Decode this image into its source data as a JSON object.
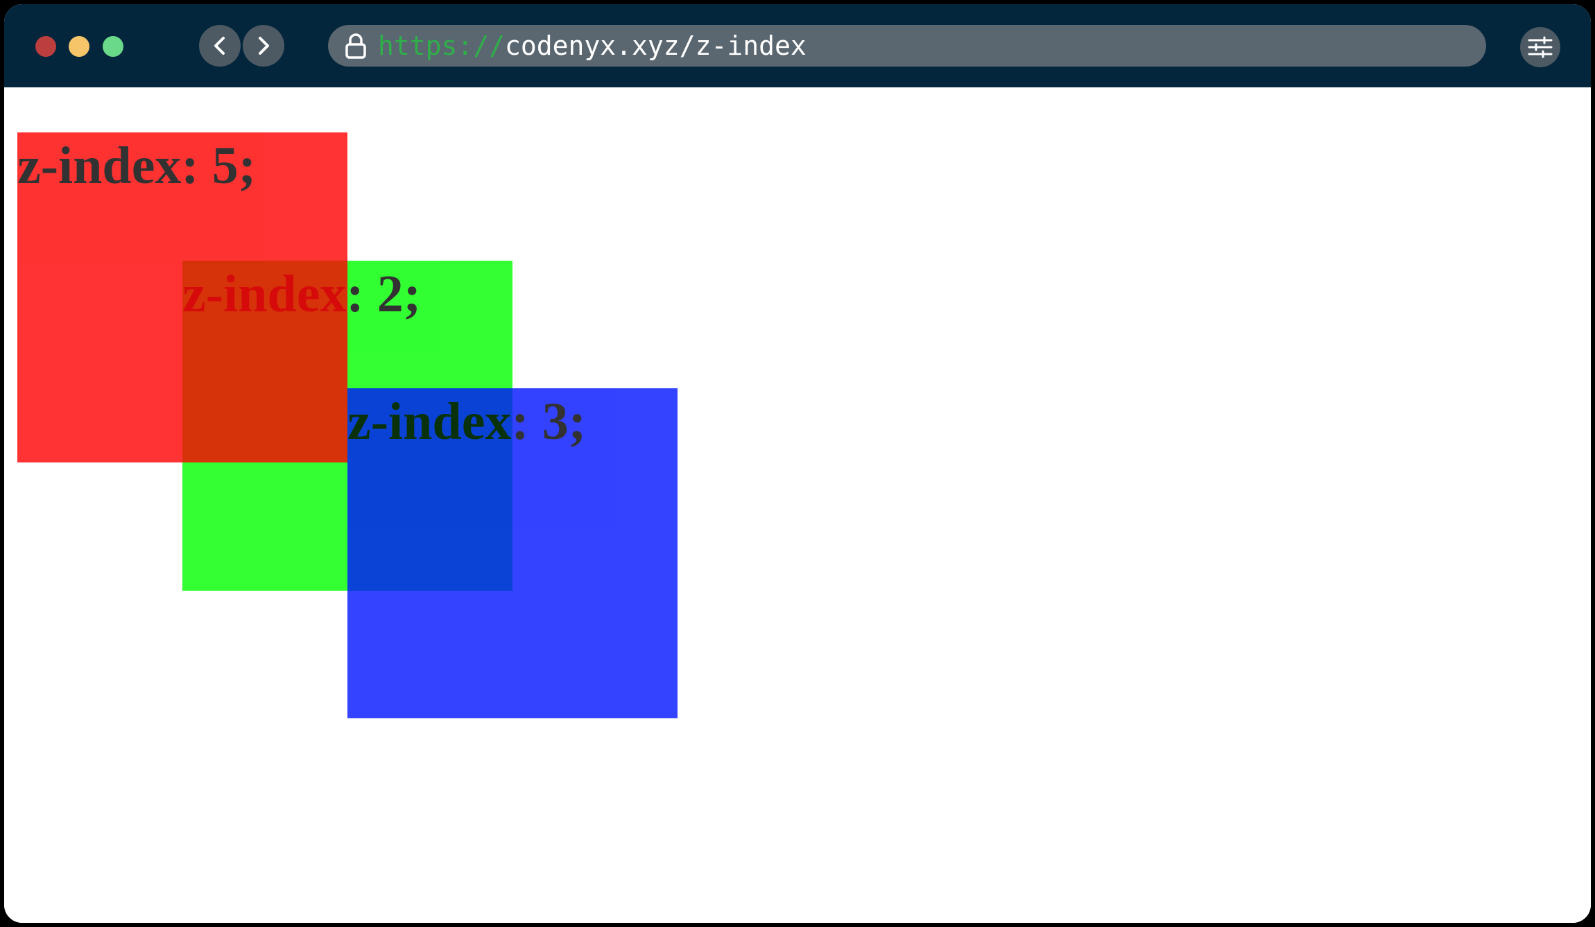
{
  "browser": {
    "url_scheme": "https://",
    "url_rest": "codenyx.xyz/z-index",
    "icons": {
      "back": "chevron-left-icon",
      "forward": "chevron-right-icon",
      "lock": "lock-icon",
      "settings": "sliders-icon"
    },
    "colors": {
      "titlebar": "#03263c",
      "close": "#bd3e3f",
      "minimize": "#f6c56a",
      "maximize": "#6ad98a",
      "scheme_text": "#2fae4a"
    }
  },
  "page": {
    "boxes": [
      {
        "label": "z-index: 5;",
        "color": "#ff0000"
      },
      {
        "label": "z-index: 2;",
        "color": "#00ff00"
      },
      {
        "label": "z-index: 3;",
        "color": "#0014ff"
      }
    ]
  }
}
